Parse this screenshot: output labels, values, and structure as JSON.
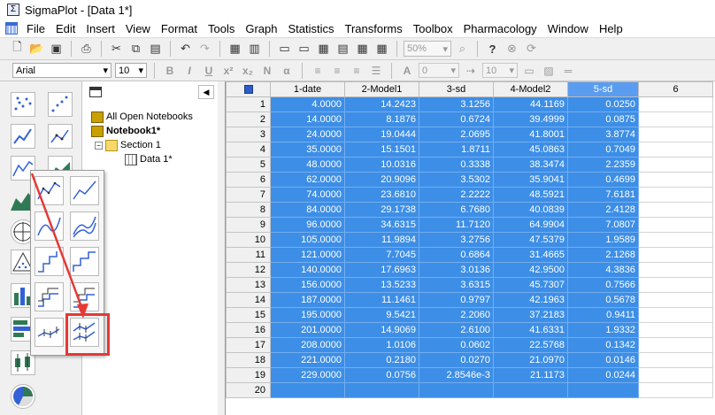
{
  "window": {
    "title": "SigmaPlot - [Data 1*]"
  },
  "menu": [
    "File",
    "Edit",
    "Insert",
    "View",
    "Format",
    "Tools",
    "Graph",
    "Statistics",
    "Transforms",
    "Toolbox",
    "Pharmacology",
    "Window",
    "Help"
  ],
  "toolbar": {
    "zoom": "50%"
  },
  "format_bar": {
    "font": "Arial",
    "size": "10",
    "combo_a": "0",
    "combo_b": "10"
  },
  "notebook": {
    "root": "All Open Notebooks",
    "notebook": "Notebook1*",
    "section": "Section 1",
    "worksheet": "Data 1*"
  },
  "worksheet": {
    "columns": [
      "1-date",
      "2-Model1",
      "3-sd",
      "4-Model2",
      "5-sd",
      "6"
    ],
    "rows": [
      [
        "4.0000",
        "14.2423",
        "3.1256",
        "44.1169",
        "0.0250"
      ],
      [
        "14.0000",
        "8.1876",
        "0.6724",
        "39.4999",
        "0.0875"
      ],
      [
        "24.0000",
        "19.0444",
        "2.0695",
        "41.8001",
        "3.8774"
      ],
      [
        "35.0000",
        "15.1501",
        "1.8711",
        "45.0863",
        "0.7049"
      ],
      [
        "48.0000",
        "10.0316",
        "0.3338",
        "38.3474",
        "2.2359"
      ],
      [
        "62.0000",
        "20.9096",
        "3.5302",
        "35.9041",
        "0.4699"
      ],
      [
        "74.0000",
        "23.6810",
        "2.2222",
        "48.5921",
        "7.6181"
      ],
      [
        "84.0000",
        "29.1738",
        "6.7680",
        "40.0839",
        "2.4128"
      ],
      [
        "96.0000",
        "34.6315",
        "11.7120",
        "64.9904",
        "7.0807"
      ],
      [
        "105.0000",
        "11.9894",
        "3.2756",
        "47.5379",
        "1.9589"
      ],
      [
        "121.0000",
        "7.7045",
        "0.6864",
        "31.4665",
        "2.1268"
      ],
      [
        "140.0000",
        "17.6963",
        "3.0136",
        "42.9500",
        "4.3836"
      ],
      [
        "156.0000",
        "13.5233",
        "3.6315",
        "45.7307",
        "0.7566"
      ],
      [
        "187.0000",
        "11.1461",
        "0.9797",
        "42.1963",
        "0.5678"
      ],
      [
        "195.0000",
        "9.5421",
        "2.2060",
        "37.2183",
        "0.9411"
      ],
      [
        "201.0000",
        "14.9069",
        "2.6100",
        "41.6331",
        "1.9332"
      ],
      [
        "208.0000",
        "1.0106",
        "0.0602",
        "22.5768",
        "0.1342"
      ],
      [
        "221.0000",
        "0.2180",
        "0.0270",
        "21.0970",
        "0.0146"
      ],
      [
        "229.0000",
        "0.0756",
        "2.8546e-3",
        "21.1173",
        "0.0244"
      ],
      [
        "",
        "",
        "",
        "",
        ""
      ]
    ]
  },
  "colors": {
    "selection": "#3d8ee6",
    "highlight_box": "#e53935"
  }
}
